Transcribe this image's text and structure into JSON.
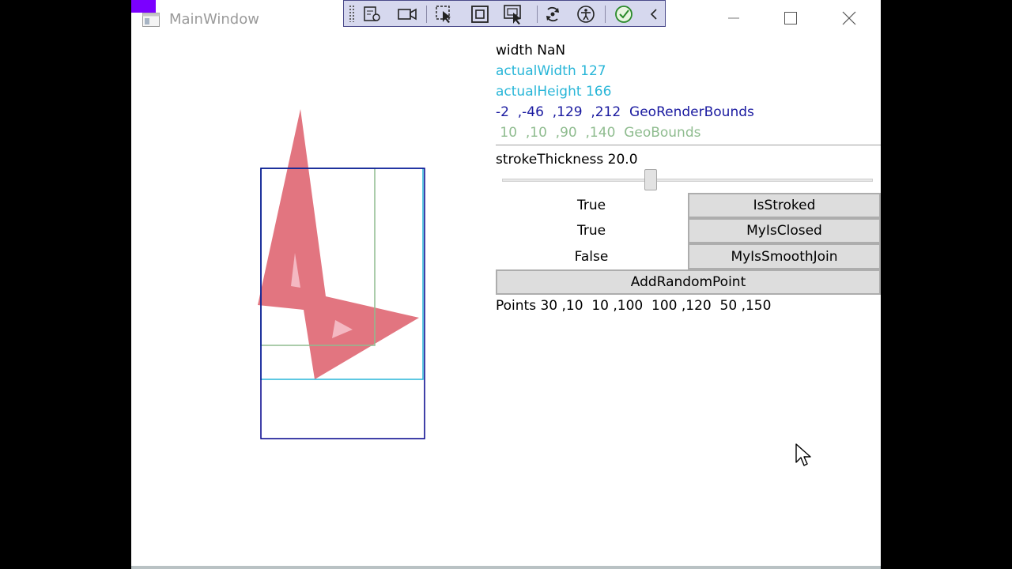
{
  "window": {
    "title": "MainWindow"
  },
  "titlebar": {
    "minimize_icon": "minimize-icon",
    "maximize_icon": "maximize-icon",
    "close_icon": "close-icon"
  },
  "debug_toolbar": {
    "icons": [
      "go-to-live-visual-tree-icon",
      "record-icon",
      "select-element-icon",
      "display-layout-adorners-icon",
      "track-focused-element-icon",
      "hot-reload-icon",
      "accessibility-icon",
      "hot-reload-status-check-icon",
      "collapse-chevron-icon"
    ]
  },
  "info": {
    "width": "width NaN",
    "actual_width": "actualWidth 127",
    "actual_height": "actualHeight 166",
    "geo_render_bounds": "-2  ,-46  ,129  ,212  GeoRenderBounds",
    "geo_bounds": " 10  ,10  ,90  ,140  GeoBounds",
    "stroke_thickness": "strokeThickness 20.0",
    "points": "Points 30 ,10  10 ,100  100 ,120  50 ,150"
  },
  "slider": {
    "value": 20.0
  },
  "toggles": [
    {
      "state": "True",
      "button": "IsStroked"
    },
    {
      "state": "True",
      "button": "MyIsClosed"
    },
    {
      "state": "False",
      "button": "MyIsSmoothJoin"
    }
  ],
  "add_button": "AddRandomPoint",
  "colors": {
    "shape_fill": "#e27580",
    "shape_hole": "#f4b8c2",
    "render_bounds": "#00008b",
    "actual_size": "#29b6d8",
    "geo_bounds": "#8fbc8f",
    "highlight": "#7b00ff"
  }
}
